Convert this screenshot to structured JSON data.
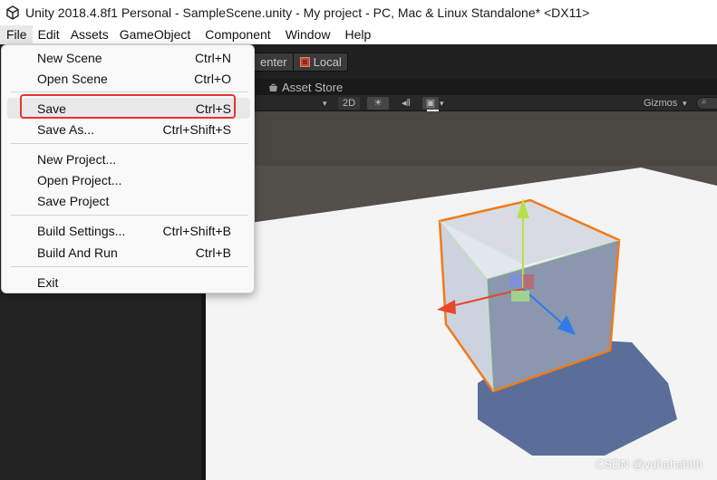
{
  "window": {
    "title": "Unity 2018.4.8f1 Personal - SampleScene.unity - My project - PC, Mac & Linux Standalone* <DX11>"
  },
  "menubar": {
    "items": [
      "File",
      "Edit",
      "Assets",
      "GameObject",
      "Component",
      "Window",
      "Help"
    ]
  },
  "toolbar": {
    "pivot_label": "Center",
    "pivot_visible": "enter",
    "space_label": "Local"
  },
  "tabs": {
    "asset_store": "Asset Store"
  },
  "scene_toolbar": {
    "mode_2d": "2D",
    "gizmos": "Gizmos"
  },
  "file_menu": {
    "groups": [
      [
        {
          "label": "New Scene",
          "shortcut": "Ctrl+N"
        },
        {
          "label": "Open Scene",
          "shortcut": "Ctrl+O"
        }
      ],
      [
        {
          "label": "Save",
          "shortcut": "Ctrl+S"
        },
        {
          "label": "Save As...",
          "shortcut": "Ctrl+Shift+S"
        }
      ],
      [
        {
          "label": "New Project...",
          "shortcut": ""
        },
        {
          "label": "Open Project...",
          "shortcut": ""
        },
        {
          "label": "Save Project",
          "shortcut": ""
        }
      ],
      [
        {
          "label": "Build Settings...",
          "shortcut": "Ctrl+Shift+B"
        },
        {
          "label": "Build And Run",
          "shortcut": "Ctrl+B"
        }
      ],
      [
        {
          "label": "Exit",
          "shortcut": ""
        }
      ]
    ],
    "highlighted_item": "Save"
  },
  "watermark": "CSDN @yuhahahhh",
  "colors": {
    "highlight_border": "#e53333",
    "cube_outline": "#f07a1a",
    "gizmo_x": "#e8452c",
    "gizmo_y": "#b7e04a",
    "gizmo_z": "#2f7be8",
    "sky": "#4a4743",
    "ground": "#f4f4f4",
    "shadow": "#4a5f8f"
  }
}
